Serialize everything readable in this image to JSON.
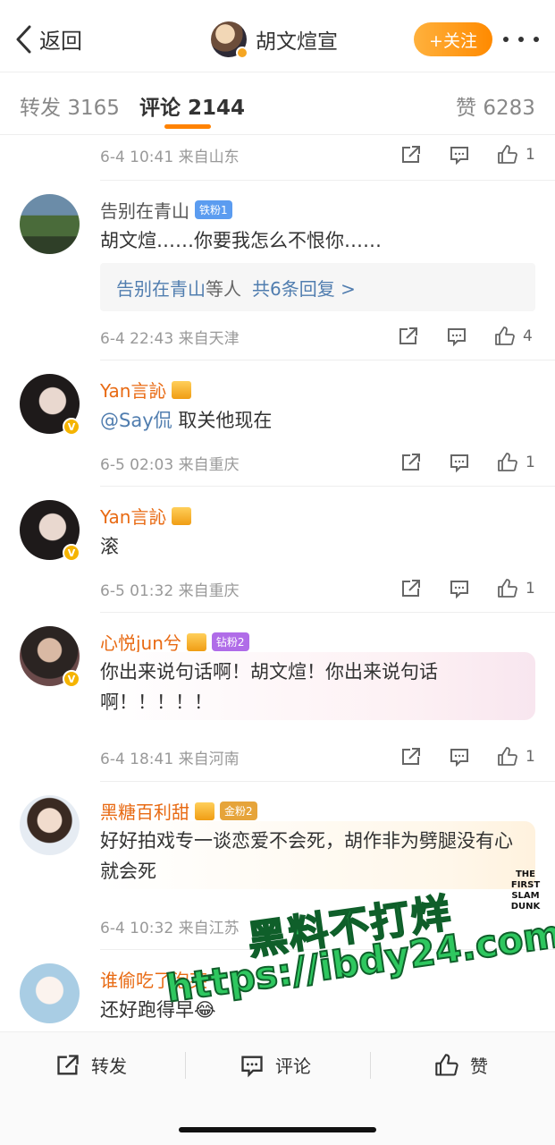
{
  "header": {
    "back_label": "返回",
    "title": "胡文煊宣",
    "follow_label": "+关注"
  },
  "tabs": {
    "repost_label": "转发",
    "repost_count": "3165",
    "comment_label": "评论",
    "comment_count": "2144",
    "like_label": "赞",
    "like_count": "6283"
  },
  "comments": [
    {
      "meta": "6-4 10:41 来自山东",
      "likes": "1"
    },
    {
      "name": "告别在青山",
      "badge": "铁粉1",
      "text": "胡文煊……你要我怎么不恨你……",
      "reply_link": "告别在青山",
      "reply_mid": "等人",
      "reply_count_text": "共6条回复 >",
      "meta": "6-4 22:43 来自天津",
      "likes": "4"
    },
    {
      "name": "Yan言訫",
      "mention": "@Say侃",
      "text": " 取关他现在",
      "meta": "6-5 02:03 来自重庆",
      "likes": "1"
    },
    {
      "name": "Yan言訫",
      "text": "滚",
      "meta": "6-5 01:32 来自重庆",
      "likes": "1"
    },
    {
      "name": "心悦jun兮",
      "badge": "钻粉2",
      "text": "你出来说句话啊！胡文煊！你出来说句话啊！！！！！",
      "meta": "6-4 18:41 来自河南",
      "likes": "1"
    },
    {
      "name": "黑糖百利甜",
      "badge": "金粉2",
      "text": "好好拍戏专一谈恋爱不会死，胡作非为劈腿没有心就会死",
      "meta": "6-4 10:32 来自江苏"
    },
    {
      "name": "谁偷吃了泡芙",
      "text": "还好跑得早😂"
    }
  ],
  "watermark": {
    "line1": "黑料不打烊",
    "line2": "https://ibdy24.com",
    "sticker": "THE FIRST SLAM DUNK"
  },
  "bottom_bar": {
    "repost": "转发",
    "comment": "评论",
    "like": "赞"
  },
  "colors": {
    "accent": "#ff8200",
    "link": "#507daf",
    "username_vip": "#e86a13"
  }
}
